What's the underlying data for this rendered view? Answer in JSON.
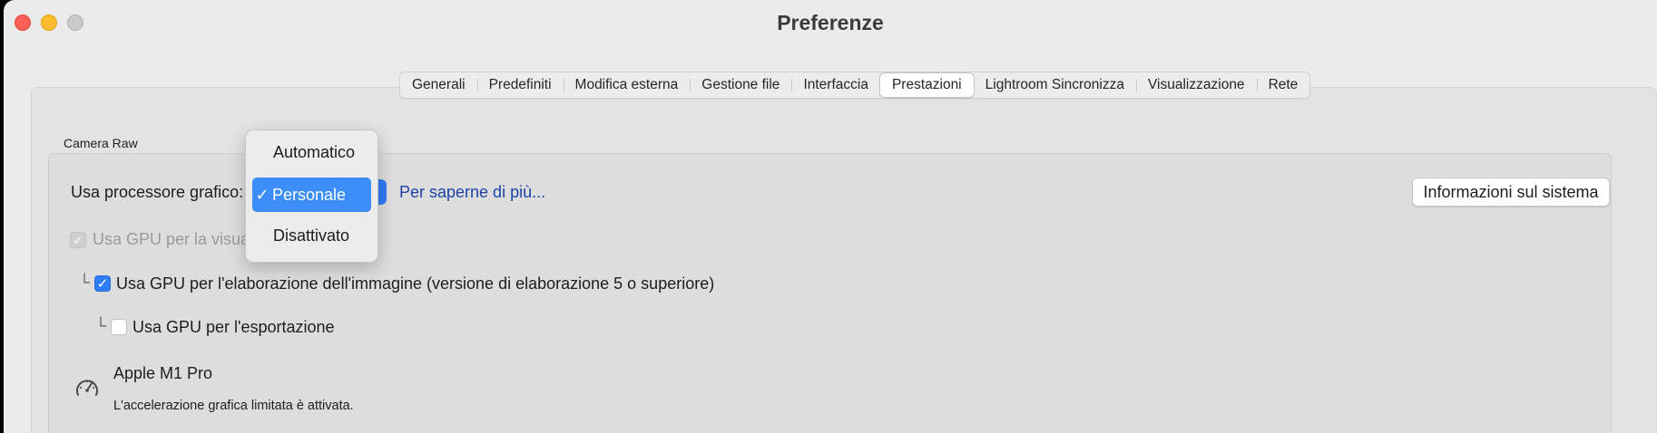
{
  "window": {
    "title": "Preferenze"
  },
  "tabs": [
    {
      "label": "Generali",
      "active": false
    },
    {
      "label": "Predefiniti",
      "active": false
    },
    {
      "label": "Modifica esterna",
      "active": false
    },
    {
      "label": "Gestione file",
      "active": false
    },
    {
      "label": "Interfaccia",
      "active": false
    },
    {
      "label": "Prestazioni",
      "active": true
    },
    {
      "label": "Lightroom Sincronizza",
      "active": false
    },
    {
      "label": "Visualizzazione",
      "active": false
    },
    {
      "label": "Rete",
      "active": false
    }
  ],
  "camera_raw": {
    "group_label": "Camera Raw",
    "gpu_label": "Usa processore grafico:",
    "learn_more": "Per saperne di più...",
    "system_info_button": "Informazioni sul sistema",
    "display_gpu_label": "Usa GPU per la visual",
    "image_gpu_label": "Usa GPU per l'elaborazione dell'immagine (versione di elaborazione 5 o superiore)",
    "export_gpu_label": "Usa GPU per l'esportazione",
    "chip_name": "Apple M1 Pro",
    "chip_note": "L'accelerazione grafica limitata è attivata."
  },
  "dropdown": {
    "options": [
      "Automatico",
      "Personale",
      "Disattivato"
    ],
    "selected": "Personale",
    "check_glyph": "✓"
  },
  "colors": {
    "accent": "#2f7df6",
    "link": "#1c43a6"
  }
}
